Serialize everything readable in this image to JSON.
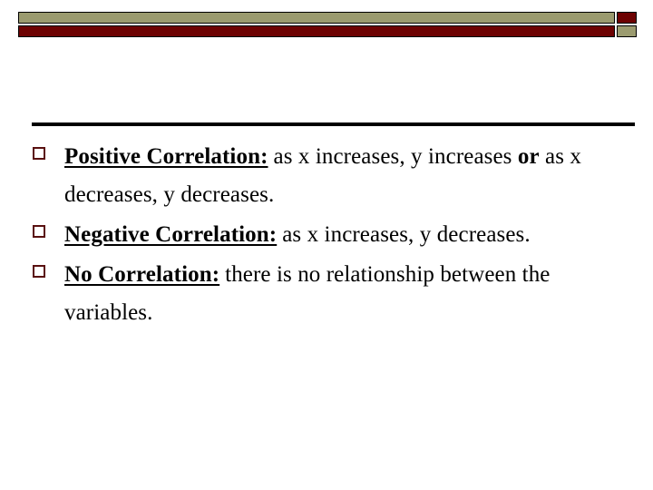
{
  "slide": {
    "background_color": "#ffffff",
    "text_color": "#000000"
  },
  "header": {
    "name": "decorative-header-band",
    "top_bar_color": "#9b9b6f",
    "top_block_color": "#6d0202",
    "bottom_bar_color": "#6d0202",
    "bottom_block_color": "#9b9b6f",
    "outline_color": "#000000"
  },
  "divider": {
    "color": "#000000"
  },
  "bullets": {
    "marker_color": "#5a1010",
    "items": [
      {
        "term": "Positive Correlation:",
        "body_before_emphasis": "as x increases, y increases ",
        "emphasis": "or",
        "body_after_emphasis": " as x decreases, y decreases."
      },
      {
        "term": "Negative Correlation:",
        "body_before_emphasis": "as x increases, y decreases.",
        "emphasis": "",
        "body_after_emphasis": ""
      },
      {
        "term": "No Correlation:",
        "body_before_emphasis": "there is no relationship between the variables.",
        "emphasis": "",
        "body_after_emphasis": ""
      }
    ]
  }
}
